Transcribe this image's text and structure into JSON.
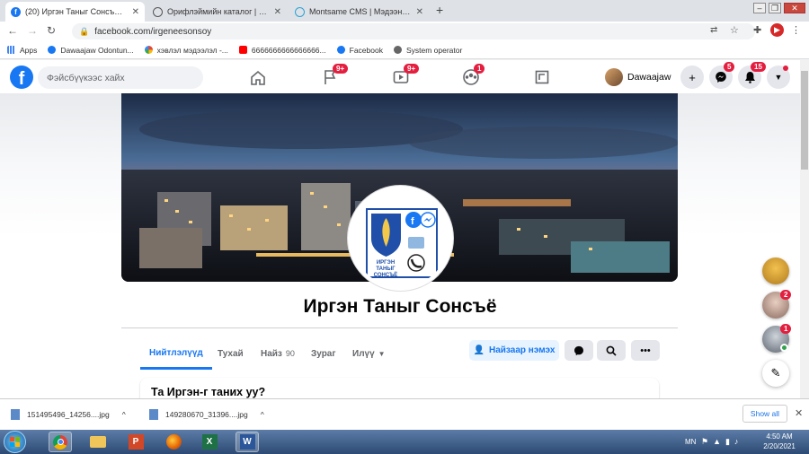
{
  "browser": {
    "tabs": [
      {
        "title": "(20) Иргэн Таныг Сонсъё | Faceb",
        "icon": "facebook-icon",
        "active": true
      },
      {
        "title": "Орифлэймийн каталог | Oriflam",
        "icon": "globe-icon",
        "active": false
      },
      {
        "title": "Montsame CMS | Мэдээний удир",
        "icon": "montsame-icon",
        "active": false
      }
    ],
    "new_tab": "+",
    "url": "facebook.com/irgeneesonsoy",
    "bookmarks": [
      {
        "label": "Apps",
        "icon": "apps-grid-icon"
      },
      {
        "label": "Dawaajaw Odontun...",
        "icon": "facebook-icon"
      },
      {
        "label": "хэвлэл мэдээлэл -...",
        "icon": "google-icon"
      },
      {
        "label": "6666666666666666...",
        "icon": "youtube-icon"
      },
      {
        "label": "Facebook",
        "icon": "facebook-icon"
      },
      {
        "label": "System operator",
        "icon": "gear-icon"
      }
    ]
  },
  "fb": {
    "logo": "f",
    "search_placeholder": "Фэйсбүүкээс хайх",
    "nav_badges": {
      "pages": "9+",
      "watch": "9+",
      "groups": "1"
    },
    "profile_name": "Dawaajaw",
    "messenger_badge": "5",
    "notif_badge": "15"
  },
  "page": {
    "name": "Иргэн Таныг Сонсъё",
    "logo_caption": "ИРГЭН ТАНЫГ СОНСЪЁ",
    "tabs": [
      "Нийтлэлүүд",
      "Тухай",
      "Найз",
      "Зураг",
      "Илүү"
    ],
    "friends_count": "90",
    "add_friend": "Найзаар нэмэх",
    "card_title": "Та Иргэн-г таних уу?"
  },
  "side": {
    "badges": [
      "2",
      "1"
    ]
  },
  "downloads": {
    "items": [
      "151495496_14256....jpg",
      "149280670_31396....jpg"
    ],
    "show_all": "Show all"
  },
  "taskbar": {
    "lang": "MN",
    "time": "4:50 AM",
    "date": "2/20/2021"
  },
  "colors": {
    "fb_blue": "#1877f2",
    "badge_red": "#e41e3f"
  }
}
